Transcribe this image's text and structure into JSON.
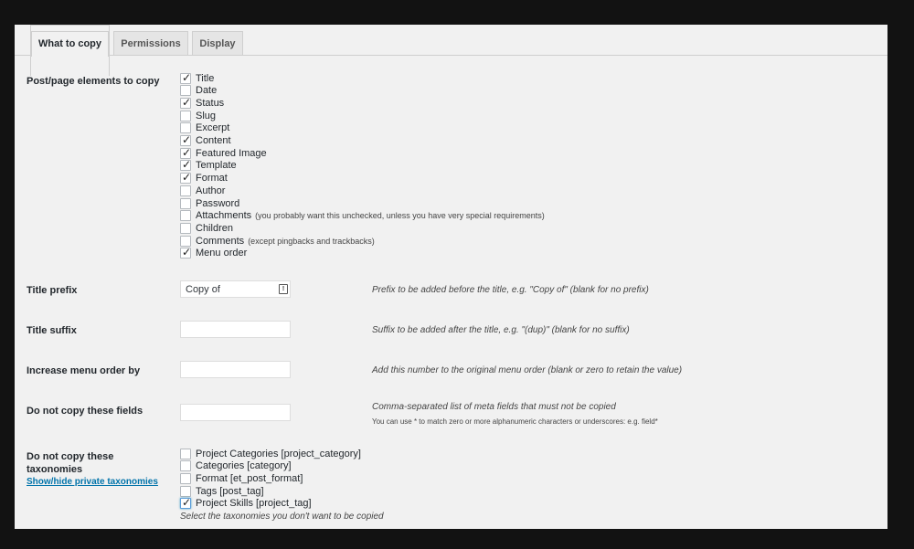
{
  "tabs": [
    {
      "label": "What to copy",
      "active": true
    },
    {
      "label": "Permissions",
      "active": false
    },
    {
      "label": "Display",
      "active": false
    }
  ],
  "elements_section": {
    "label": "Post/page elements to copy",
    "items": [
      {
        "label": "Title",
        "checked": true,
        "note": ""
      },
      {
        "label": "Date",
        "checked": false,
        "note": ""
      },
      {
        "label": "Status",
        "checked": true,
        "note": ""
      },
      {
        "label": "Slug",
        "checked": false,
        "note": ""
      },
      {
        "label": "Excerpt",
        "checked": false,
        "note": ""
      },
      {
        "label": "Content",
        "checked": true,
        "note": ""
      },
      {
        "label": "Featured Image",
        "checked": true,
        "note": ""
      },
      {
        "label": "Template",
        "checked": true,
        "note": ""
      },
      {
        "label": "Format",
        "checked": true,
        "note": ""
      },
      {
        "label": "Author",
        "checked": false,
        "note": ""
      },
      {
        "label": "Password",
        "checked": false,
        "note": ""
      },
      {
        "label": "Attachments",
        "checked": false,
        "note": "(you probably want this unchecked, unless you have very special requirements)"
      },
      {
        "label": "Children",
        "checked": false,
        "note": ""
      },
      {
        "label": "Comments",
        "checked": false,
        "note": "(except pingbacks and trackbacks)"
      },
      {
        "label": "Menu order",
        "checked": true,
        "note": ""
      }
    ]
  },
  "title_prefix": {
    "label": "Title prefix",
    "value": "Copy of",
    "description": "Prefix to be added before the title, e.g. \"Copy of\" (blank for no prefix)"
  },
  "title_suffix": {
    "label": "Title suffix",
    "value": "",
    "description": "Suffix to be added after the title, e.g. \"(dup)\" (blank for no suffix)"
  },
  "menu_order": {
    "label": "Increase menu order by",
    "value": "",
    "description": "Add this number to the original menu order (blank or zero to retain the value)"
  },
  "exclude_fields": {
    "label": "Do not copy these fields",
    "value": "",
    "description": "Comma-separated list of meta fields that must not be copied",
    "hint": "You can use * to match zero or more alphanumeric characters or underscores: e.g. field*"
  },
  "taxonomies": {
    "label_line1": "Do not copy these",
    "label_line2": "taxonomies",
    "toggle_link": "Show/hide private taxonomies",
    "items": [
      {
        "label": "Project Categories [project_category]",
        "checked": false
      },
      {
        "label": "Categories [category]",
        "checked": false
      },
      {
        "label": "Format [et_post_format]",
        "checked": false
      },
      {
        "label": "Tags [post_tag]",
        "checked": false
      },
      {
        "label": "Project Skills [project_tag]",
        "checked": true
      }
    ],
    "help": "Select the taxonomies you don't want to be copied"
  }
}
